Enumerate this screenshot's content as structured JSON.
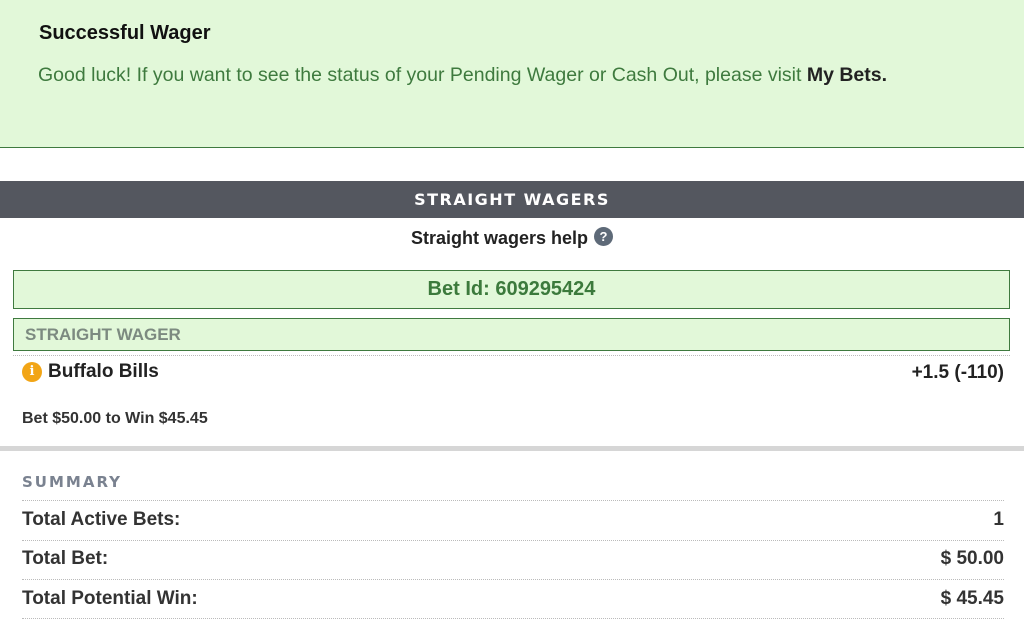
{
  "banner": {
    "title": "Successful Wager",
    "message": "Good luck! If you want to see the status of your Pending Wager or Cash Out, please visit ",
    "link_text": "My Bets."
  },
  "section": {
    "header": "STRAIGHT WAGERS",
    "help_text": "Straight wagers help",
    "help_icon": "question-circle-icon"
  },
  "bet": {
    "bet_id_text": "Bet Id: 609295424",
    "wager_type": "STRAIGHT WAGER",
    "team": "Buffalo Bills",
    "line": "+1.5 (-110)",
    "bet_text": "Bet $50.00 to Win $45.45",
    "info_icon": "info-icon"
  },
  "summary": {
    "label": "SUMMARY",
    "rows": [
      {
        "label": "Total Active Bets:",
        "value": "1"
      },
      {
        "label": "Total Bet:",
        "value": "$ 50.00"
      },
      {
        "label": "Total Potential Win:",
        "value": "$ 45.45"
      }
    ]
  },
  "colors": {
    "success_bg": "#e2f8d9",
    "success_text": "#3e7a3e",
    "header_bg": "#54575f",
    "info_icon": "#f2a516"
  }
}
